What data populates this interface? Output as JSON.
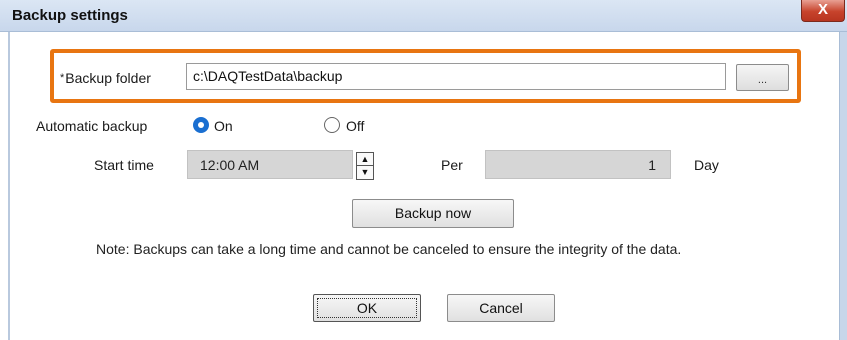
{
  "window": {
    "title": "Backup settings",
    "close_glyph": "X"
  },
  "backup_folder": {
    "required_marker": "*",
    "label": "Backup folder",
    "value": "c:\\DAQTestData\\backup",
    "browse_label": "..."
  },
  "automatic_backup": {
    "label": "Automatic backup",
    "options": [
      {
        "label": "On",
        "selected": true
      },
      {
        "label": "Off",
        "selected": false
      }
    ]
  },
  "schedule": {
    "start_label": "Start time",
    "start_value": "12:00 AM",
    "spin_up_icon": "triangle-up-icon",
    "spin_down_icon": "triangle-down-icon",
    "per_label": "Per",
    "per_value": "1",
    "unit_label": "Day"
  },
  "backup_now_label": "Backup now",
  "note": "Note: Backups can take a long time and cannot be canceled to ensure the integrity of the data.",
  "buttons": {
    "ok": "OK",
    "cancel": "Cancel"
  },
  "colors": {
    "highlight": "#e87511",
    "radio_selected": "#1a6fd1",
    "close_button": "#c7432c"
  }
}
